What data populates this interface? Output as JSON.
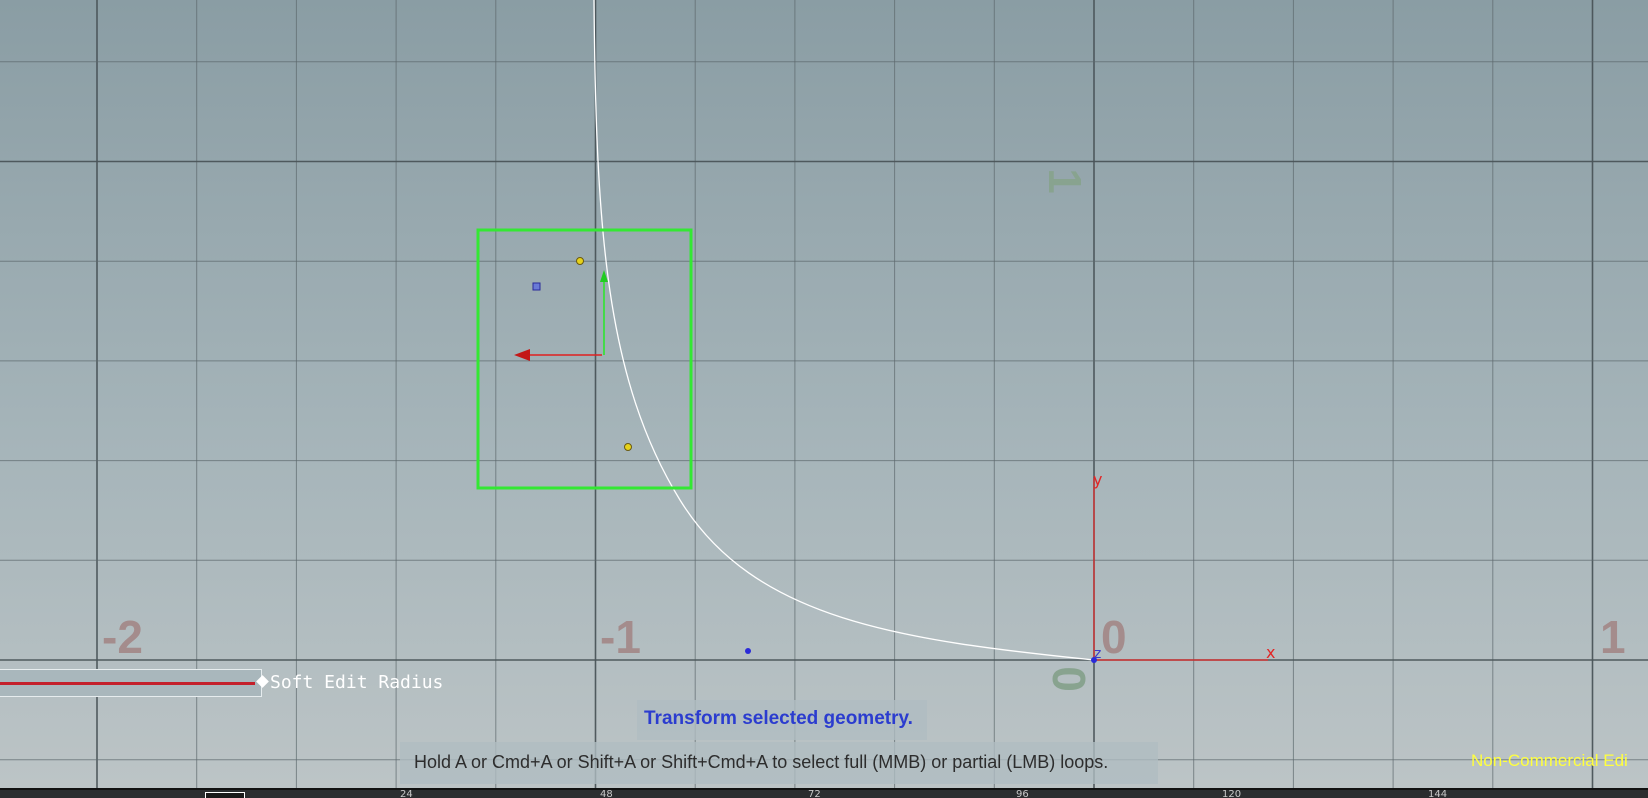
{
  "viewport": {
    "axis_numbers": {
      "horizontal": [
        "-2",
        "-1",
        "0",
        "1"
      ],
      "vertical": [
        "1",
        "0"
      ]
    },
    "axis_letters": {
      "x": "x",
      "y": "y",
      "z": "z"
    }
  },
  "soft_edit": {
    "label": "Soft Edit Radius",
    "value_fraction": 1.0
  },
  "tool_title": "Transform selected geometry.",
  "hint": "Hold A or Cmd+A or Shift+A or Shift+Cmd+A to select full (MMB) or partial (LMB) loops.",
  "license_badge": "Non-Commercial Edi",
  "timeline": {
    "frame_labels": [
      "24",
      "48",
      "72",
      "96",
      "120",
      "144"
    ]
  },
  "colors": {
    "selection_box": "#33e833",
    "curve": "#ffffff",
    "handle_x": "#e02020",
    "handle_y": "#2ee52e",
    "origin_axes": "#e22626",
    "control_point": "#e6d21a",
    "primitive_point": "#2a2ad8",
    "tool_title": "#2b3ccf",
    "license_badge": "#ffff3e"
  }
}
